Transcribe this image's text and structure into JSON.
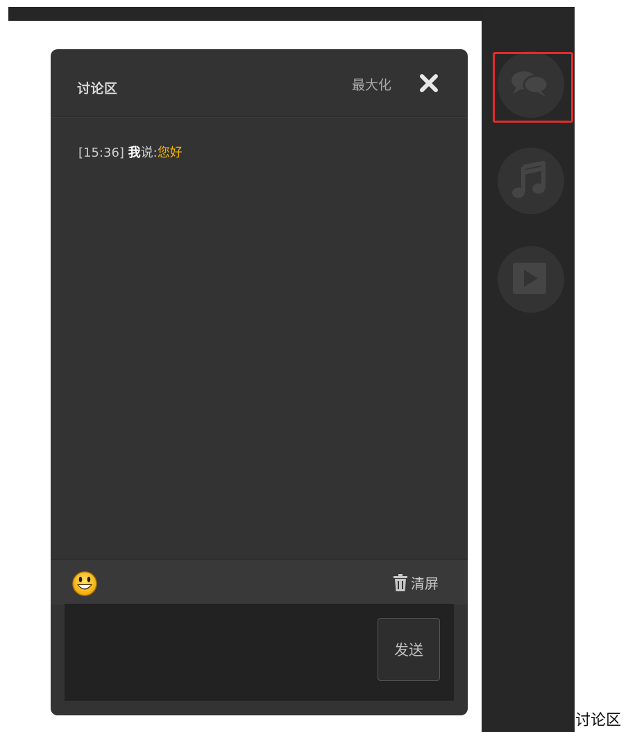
{
  "panel": {
    "title": "讨论区",
    "maximize_label": "最大化",
    "close_icon": "close-icon"
  },
  "messages": [
    {
      "time": "[15:36]",
      "sender": "我",
      "said": "说:",
      "text": "您好"
    }
  ],
  "toolbar": {
    "emoji_icon": "emoji-icon",
    "clear_icon": "trash-icon",
    "clear_label": "清屏"
  },
  "input": {
    "value": "",
    "send_label": "发送"
  },
  "sidebar": {
    "items": [
      {
        "name": "chat-bubbles-icon",
        "active": true
      },
      {
        "name": "music-note-icon",
        "active": false
      },
      {
        "name": "play-icon",
        "active": false
      }
    ]
  },
  "bottom_label": "讨论区",
  "colors": {
    "panel_bg": "#333333",
    "strip_bg": "#272727",
    "message_text": "#f5b400",
    "highlight": "#e42b2b"
  }
}
